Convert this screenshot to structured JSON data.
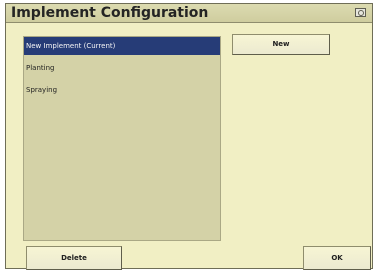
{
  "window": {
    "title": "Implement Configuration",
    "title_icon": "window-menu-icon"
  },
  "implements": {
    "items": [
      {
        "label": "New Implement (Current)",
        "selected": true
      },
      {
        "label": "Planting",
        "selected": false
      },
      {
        "label": "Spraying",
        "selected": false
      }
    ]
  },
  "buttons": {
    "new_label": "New",
    "delete_label": "Delete",
    "ok_label": "OK"
  },
  "colors": {
    "window_background": "#f1efc4",
    "list_background": "#d4d2a7",
    "selection": "#263c77"
  }
}
